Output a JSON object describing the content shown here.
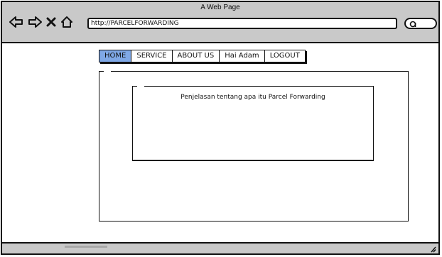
{
  "window": {
    "title": "A Web Page"
  },
  "browser": {
    "url": "http://PARCELFORWARDING",
    "icons": [
      "back-arrow-icon",
      "forward-arrow-icon",
      "close-icon",
      "home-icon",
      "search-icon"
    ]
  },
  "nav": {
    "items": [
      {
        "label": "HOME",
        "active": true
      },
      {
        "label": "SERVICE",
        "active": false
      },
      {
        "label": "ABOUT US",
        "active": false
      },
      {
        "label": "Hai Adam",
        "active": false
      },
      {
        "label": "LOGOUT",
        "active": false
      }
    ]
  },
  "content": {
    "text": "Penjelasan tentang apa itu Parcel Forwarding"
  },
  "colors": {
    "chrome": "#c9c9c9",
    "active_tab": "#7fa8e6",
    "border": "#111111"
  }
}
